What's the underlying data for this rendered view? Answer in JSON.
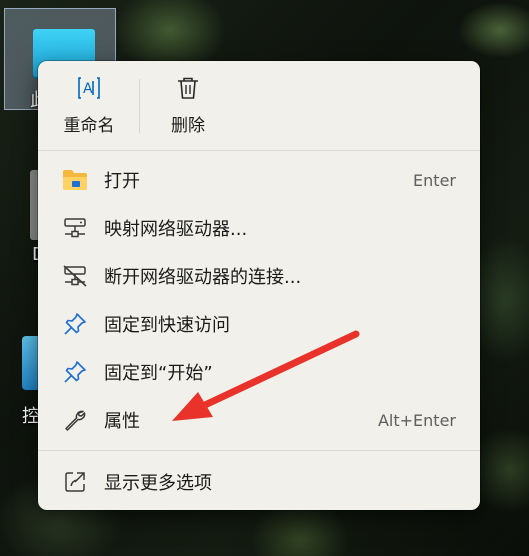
{
  "desktop": {
    "labels": [
      "此",
      "D",
      "控"
    ]
  },
  "context_menu": {
    "quick_actions": [
      {
        "label": "重命名",
        "icon": "rename-icon"
      },
      {
        "label": "删除",
        "icon": "trash-icon"
      }
    ],
    "items": [
      {
        "label": "打开",
        "shortcut": "Enter",
        "icon": "folder-icon"
      },
      {
        "label": "映射网络驱动器...",
        "shortcut": "",
        "icon": "network-drive-icon"
      },
      {
        "label": "断开网络驱动器的连接...",
        "shortcut": "",
        "icon": "disconnect-drive-icon"
      },
      {
        "label": "固定到快速访问",
        "shortcut": "",
        "icon": "pin-icon"
      },
      {
        "label": "固定到“开始”",
        "shortcut": "",
        "icon": "pin-icon"
      },
      {
        "label": "属性",
        "shortcut": "Alt+Enter",
        "icon": "wrench-icon"
      }
    ],
    "more_options": {
      "label": "显示更多选项",
      "icon": "share-icon"
    }
  },
  "colors": {
    "accent": "#0067c0",
    "arrow": "#e8322a",
    "menu_bg": "#f1f0ea"
  }
}
